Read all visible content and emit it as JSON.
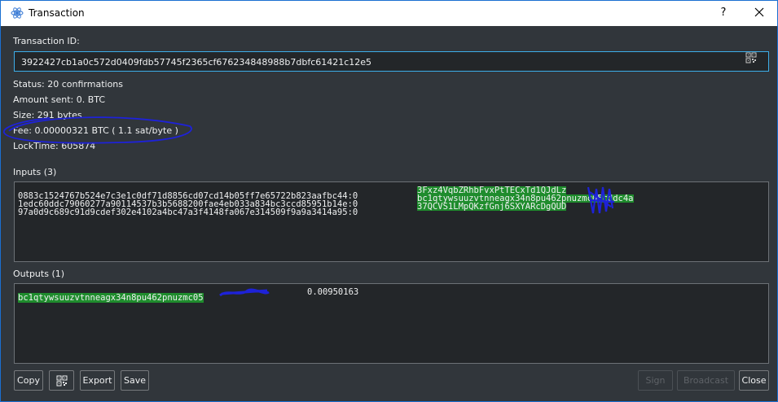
{
  "window": {
    "title": "Transaction",
    "help_label": "?"
  },
  "txid": {
    "label": "Transaction ID:",
    "value": "3922427cb1a0c572d0409fdb57745f2365cf676234848988b7dbfc61421c12e5"
  },
  "info": {
    "status": "Status: 20 confirmations",
    "amount_sent": "Amount sent: 0. BTC",
    "size": "Size: 291 bytes",
    "fee": "Fee: 0.00000321 BTC  ( 1.1 sat/byte )",
    "locktime": "LockTime: 605874"
  },
  "inputs": {
    "label": "Inputs (3)",
    "rows": [
      {
        "prevout": "0883c1524767b524e7c3e1c0df71d8856cd07cd14b05ff7e65722b823aafbc44:0",
        "address": "3Fxz4VqbZRhbFvxPtTECxTd1QJdLz"
      },
      {
        "prevout": "1edc60ddc79060277a90114537b3b5688200fae4eb033a834bc3ccd85951b14e:0",
        "address": "bc1qtywsuuzvtnneagx34n8pu462pnuzmc05cddc4a"
      },
      {
        "prevout": "97a0d9c689c91d9cdef302e4102a4bc47a3f4148fa067e314509f9a9a3414a95:0",
        "address": "37QCVS1LMpQKzfGnj6SXYARcDgQUD"
      }
    ]
  },
  "outputs": {
    "label": "Outputs (1)",
    "rows": [
      {
        "address": "bc1qtywsuuzvtnneagx34n8pu462pnuzmc05",
        "amount": "0.00950163"
      }
    ]
  },
  "buttons": {
    "copy": "Copy",
    "qr_icon": "qr-code-icon",
    "export": "Export",
    "save": "Save",
    "sign": "Sign",
    "broadcast": "Broadcast",
    "close": "Close"
  },
  "colors": {
    "accent": "#3daee9",
    "address_highlight": "#1f8c2d",
    "annotation_ink": "#1e22d8"
  }
}
